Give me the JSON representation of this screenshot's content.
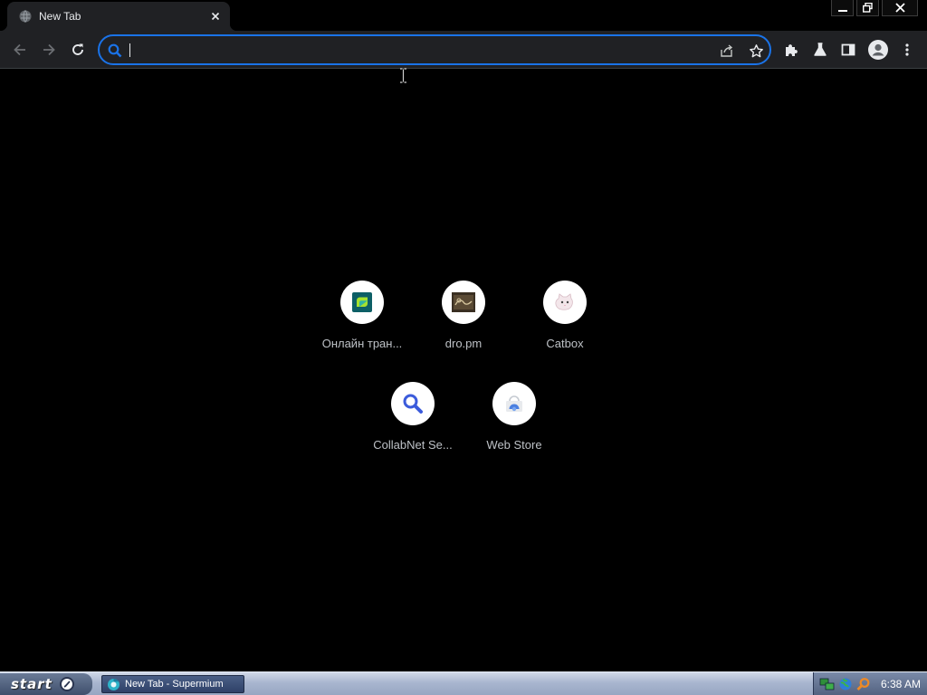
{
  "browser": {
    "tab": {
      "title": "New Tab",
      "favicon": "globe-icon"
    },
    "window_controls": [
      "minimize-icon",
      "restore-icon",
      "close-icon"
    ],
    "toolbar": {
      "back_icon": "arrow-left-icon",
      "forward_icon": "arrow-right-icon",
      "reload_icon": "reload-icon",
      "omnibox": {
        "value": "",
        "placeholder": "",
        "search_icon": "search-icon",
        "share_icon": "share-icon",
        "bookmark_icon": "star-icon"
      },
      "extensions_icon": "puzzle-icon",
      "labs_icon": "flask-icon",
      "side_panel_icon": "side-panel-icon",
      "profile_icon": "avatar-icon",
      "menu_icon": "kebab-menu-icon"
    }
  },
  "ntp": {
    "shortcuts": [
      {
        "label": "Онлайн тран...",
        "icon": "green-square-logo-icon"
      },
      {
        "label": "dro.pm",
        "icon": "dro-pm-logo-icon"
      },
      {
        "label": "Catbox",
        "icon": "cat-logo-icon"
      },
      {
        "label": "CollabNet Se...",
        "icon": "magnifier-icon"
      },
      {
        "label": "Web Store",
        "icon": "web-store-icon"
      }
    ]
  },
  "taskbar": {
    "start_label": "start",
    "active_window": "New Tab - Supermium",
    "tray_icons": [
      "network-icon",
      "globe-tray-icon",
      "search-tray-icon"
    ],
    "clock": "6:38 AM"
  },
  "colors": {
    "accent": "#1a73e8",
    "toolbar": "#202124",
    "page_bg": "#000000",
    "label": "#bdc1c6"
  }
}
